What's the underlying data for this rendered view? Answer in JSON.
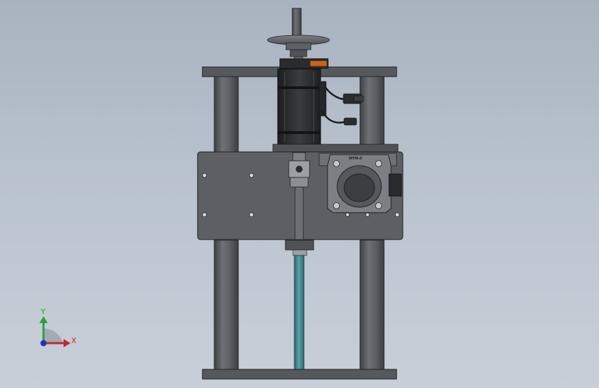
{
  "triad": {
    "x_label": "X",
    "y_label": "Y",
    "x_color": "#c0282e",
    "y_color": "#2aa13a",
    "z_color": "#1f35b8"
  },
  "model": {
    "frame_color": "#5c5f63",
    "shaft_color": "#3f7f86",
    "accent_color": "#c8641e",
    "plate_emboss": "MTM-II"
  }
}
